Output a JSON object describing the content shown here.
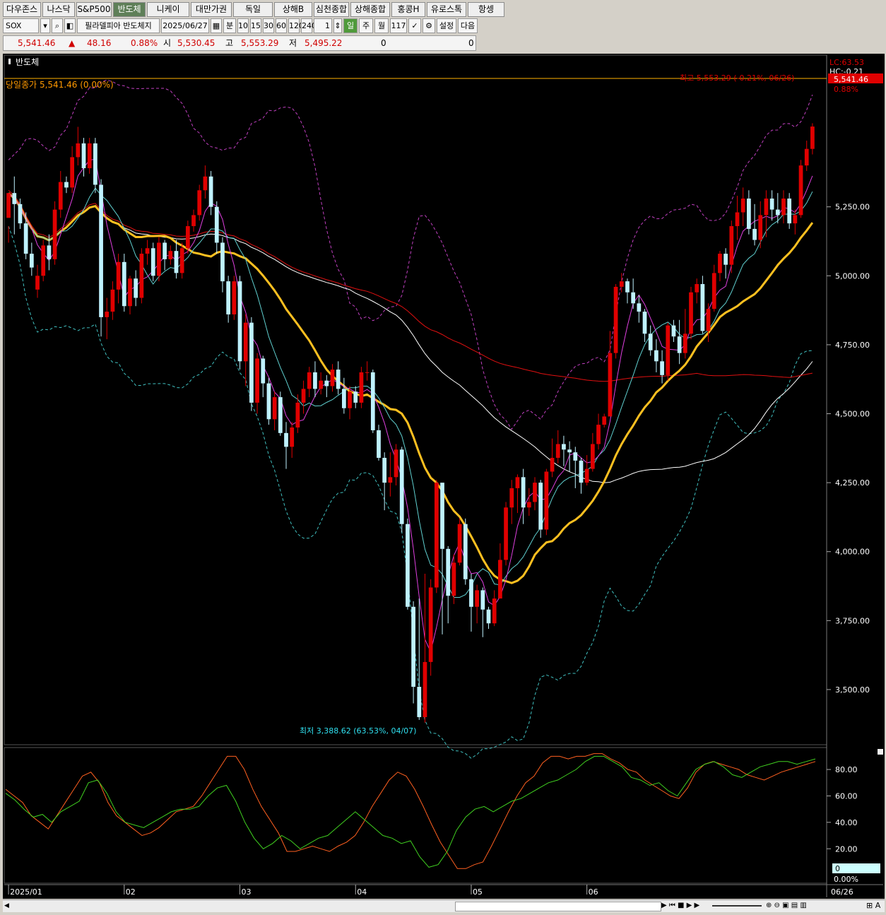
{
  "tabs": [
    {
      "label": "다우존스",
      "w": 52
    },
    {
      "label": "나스닥",
      "w": 44
    },
    {
      "label": "S&P500",
      "w": 48
    },
    {
      "label": "반도체",
      "w": 44,
      "active": true
    },
    {
      "label": "니케이",
      "w": 58
    },
    {
      "label": "대만가권",
      "w": 56
    },
    {
      "label": "독일",
      "w": 54
    },
    {
      "label": "상해B",
      "w": 52
    },
    {
      "label": "심천종합",
      "w": 48
    },
    {
      "label": "상해종합",
      "w": 54
    },
    {
      "label": "홍콩H",
      "w": 46
    },
    {
      "label": "유로스톡",
      "w": 54
    },
    {
      "label": "항셍",
      "w": 50
    }
  ],
  "toolbar": {
    "symbol": "SOX",
    "name": "필라델피아 반도체지",
    "date": "2025/06/27",
    "unit_buttons": [
      "분",
      "10",
      "15",
      "30",
      "60",
      "120",
      "240"
    ],
    "period_count": "1",
    "period_buttons": [
      "일",
      "주",
      "월"
    ],
    "bar_count": "117",
    "settings_label": "설정",
    "next_label": "다음"
  },
  "quote": {
    "price": "5,541.46",
    "arrow": "▲",
    "change": "48.16",
    "pct": "0.88%",
    "open_label": "시",
    "open": "5,530.45",
    "high_label": "고",
    "high": "5,553.29",
    "low_label": "저",
    "low": "5,495.22",
    "vol1": "0",
    "vol2": "0"
  },
  "chart_title": "반도체",
  "legend_close": "당일종가 5,541.46 (0.00%)",
  "high_note": "최고 5,553.29 (-0.21%, 06/26)",
  "low_note": "최저 3,388.62 (63.53%, 04/07)",
  "right_badges": {
    "lc": "LC:63.53",
    "hc": "HC:-0.21",
    "price": "5,541.46",
    "pct": "0.88%",
    "pct_low": "0.00%",
    "stoch_val": "0"
  },
  "colors": {
    "up": "#e00000",
    "down": "#bff2ff",
    "ma5": "#e040e0",
    "ma10": "#60d0d0",
    "ma20": "#ffc020",
    "ma60": "#ffffff",
    "ma120": "#e01010",
    "band_up": "#c040c0",
    "band_dn": "#40c0c0",
    "stoch_k": "#ff6020",
    "stoch_d": "#40d020"
  },
  "chart_data": [
    {
      "type": "candlestick",
      "title": "반도체",
      "y_ticks": [
        5250,
        5000,
        4750,
        4500,
        4250,
        4000,
        3750,
        3500
      ],
      "ylim": [
        3300,
        5800
      ],
      "x_labels": [
        "2025/01",
        "02",
        "03",
        "04",
        "05",
        "06",
        "06/26"
      ],
      "x_label_index": [
        0,
        20,
        40,
        60,
        80,
        100,
        115
      ],
      "candles": [
        [
          5210,
          5300,
          5180,
          5120
        ],
        [
          5300,
          5260,
          5360,
          5150
        ],
        [
          5260,
          5190,
          5280,
          5170
        ],
        [
          5190,
          5080,
          5230,
          5060
        ],
        [
          5080,
          5030,
          5120,
          5000
        ],
        [
          4950,
          5000,
          5040,
          4920
        ],
        [
          5000,
          5110,
          5130,
          4980
        ],
        [
          5110,
          5060,
          5150,
          5020
        ],
        [
          5060,
          5240,
          5270,
          5040
        ],
        [
          5240,
          5340,
          5380,
          5210
        ],
        [
          5340,
          5320,
          5360,
          5300
        ],
        [
          5320,
          5430,
          5470,
          5300
        ],
        [
          5430,
          5480,
          5540,
          5400
        ],
        [
          5480,
          5390,
          5500,
          5360
        ],
        [
          5390,
          5480,
          5500,
          5370
        ],
        [
          5480,
          5330,
          5500,
          5300
        ],
        [
          5330,
          4850,
          5350,
          4780
        ],
        [
          4850,
          4870,
          4920,
          4770
        ],
        [
          4870,
          4950,
          4980,
          4840
        ],
        [
          4950,
          5050,
          5080,
          4900
        ],
        [
          5050,
          4890,
          5080,
          4870
        ],
        [
          4890,
          4990,
          5000,
          4860
        ],
        [
          4990,
          4920,
          5020,
          4890
        ],
        [
          4920,
          5080,
          5100,
          4900
        ],
        [
          5080,
          5100,
          5130,
          5040
        ],
        [
          5100,
          5000,
          5120,
          4980
        ],
        [
          5000,
          5120,
          5140,
          4980
        ],
        [
          5120,
          5060,
          5130,
          5020
        ],
        [
          5060,
          5090,
          5110,
          5040
        ],
        [
          5090,
          5010,
          5130,
          4990
        ],
        [
          5010,
          5100,
          5120,
          4990
        ],
        [
          5100,
          5180,
          5200,
          5080
        ],
        [
          5180,
          5220,
          5240,
          5160
        ],
        [
          5220,
          5310,
          5330,
          5200
        ],
        [
          5310,
          5360,
          5400,
          5280
        ],
        [
          5360,
          5250,
          5380,
          5220
        ],
        [
          5250,
          5120,
          5270,
          5080
        ],
        [
          5120,
          4980,
          5140,
          4940
        ],
        [
          4980,
          4860,
          5000,
          4830
        ],
        [
          4860,
          4980,
          5000,
          4840
        ],
        [
          4980,
          4690,
          5000,
          4660
        ],
        [
          4690,
          4830,
          4860,
          4600
        ],
        [
          4830,
          4540,
          4850,
          4510
        ],
        [
          4540,
          4700,
          4720,
          4500
        ],
        [
          4700,
          4610,
          4710,
          4560
        ],
        [
          4610,
          4480,
          4630,
          4460
        ],
        [
          4480,
          4560,
          4580,
          4440
        ],
        [
          4560,
          4430,
          4580,
          4420
        ],
        [
          4430,
          4380,
          4470,
          4300
        ],
        [
          4380,
          4450,
          4470,
          4340
        ],
        [
          4450,
          4540,
          4570,
          4430
        ],
        [
          4540,
          4590,
          4620,
          4500
        ],
        [
          4590,
          4650,
          4670,
          4560
        ],
        [
          4650,
          4590,
          4690,
          4560
        ],
        [
          4590,
          4620,
          4650,
          4570
        ],
        [
          4620,
          4600,
          4640,
          4560
        ],
        [
          4600,
          4660,
          4680,
          4580
        ],
        [
          4660,
          4590,
          4690,
          4570
        ],
        [
          4590,
          4520,
          4630,
          4500
        ],
        [
          4520,
          4580,
          4600,
          4480
        ],
        [
          4580,
          4540,
          4600,
          4520
        ],
        [
          4540,
          4650,
          4670,
          4520
        ],
        [
          4650,
          4650,
          4690,
          4620
        ],
        [
          4650,
          4440,
          4660,
          4430
        ],
        [
          4440,
          4340,
          4460,
          4330
        ],
        [
          4340,
          4250,
          4360,
          4150
        ],
        [
          4250,
          4270,
          4360,
          4200
        ],
        [
          4270,
          4370,
          4390,
          4240
        ],
        [
          4370,
          4100,
          4380,
          4070
        ],
        [
          4100,
          3800,
          4120,
          3790
        ],
        [
          3800,
          3510,
          3820,
          3450
        ],
        [
          3510,
          3400,
          3830,
          3390
        ],
        [
          3400,
          3600,
          3920,
          3380
        ],
        [
          3600,
          3870,
          3900,
          3550
        ],
        [
          3870,
          4250,
          4260,
          3850
        ],
        [
          4250,
          4010,
          4030,
          3700
        ],
        [
          4010,
          3840,
          4020,
          3740
        ],
        [
          3840,
          3960,
          3990,
          3810
        ],
        [
          3960,
          4100,
          4120,
          3950
        ],
        [
          4100,
          3900,
          4120,
          3880
        ],
        [
          3900,
          3800,
          3920,
          3710
        ],
        [
          3800,
          3860,
          3880,
          3740
        ],
        [
          3860,
          3790,
          3870,
          3690
        ],
        [
          3790,
          3740,
          3800,
          3720
        ],
        [
          3740,
          3830,
          3860,
          3730
        ],
        [
          3830,
          3970,
          4030,
          3960
        ],
        [
          3970,
          4160,
          4180,
          3950
        ],
        [
          4160,
          4230,
          4260,
          4100
        ],
        [
          4230,
          4270,
          4280,
          4140
        ],
        [
          4270,
          4160,
          4300,
          4100
        ],
        [
          4160,
          4180,
          4230,
          4130
        ],
        [
          4180,
          4250,
          4270,
          4150
        ],
        [
          4250,
          4080,
          4260,
          4050
        ],
        [
          4080,
          4290,
          4300,
          4060
        ],
        [
          4290,
          4340,
          4410,
          4270
        ],
        [
          4340,
          4390,
          4440,
          4320
        ],
        [
          4390,
          4370,
          4420,
          4310
        ],
        [
          4370,
          4360,
          4400,
          4290
        ],
        [
          4360,
          4330,
          4380,
          4230
        ],
        [
          4330,
          4250,
          4340,
          4210
        ],
        [
          4250,
          4300,
          4350,
          4240
        ],
        [
          4300,
          4390,
          4430,
          4290
        ],
        [
          4390,
          4460,
          4500,
          4370
        ],
        [
          4460,
          4490,
          4500,
          4450
        ],
        [
          4490,
          4720,
          4800,
          4710
        ],
        [
          4720,
          4960,
          4970,
          4700
        ],
        [
          4960,
          4980,
          5010,
          4940
        ],
        [
          4980,
          4940,
          4990,
          4900
        ],
        [
          4940,
          4900,
          4990,
          4880
        ],
        [
          4900,
          4870,
          4930,
          4830
        ],
        [
          4870,
          4790,
          4880,
          4760
        ],
        [
          4790,
          4730,
          4820,
          4710
        ],
        [
          4730,
          4690,
          4770,
          4650
        ],
        [
          4690,
          4640,
          4730,
          4610
        ],
        [
          4640,
          4820,
          4830,
          4620
        ],
        [
          4820,
          4780,
          4840,
          4760
        ],
        [
          4780,
          4720,
          4840,
          4680
        ],
        [
          4720,
          4790,
          4880,
          4700
        ],
        [
          4790,
          4940,
          4960,
          4770
        ],
        [
          4940,
          4970,
          4990,
          4900
        ],
        [
          4970,
          4800,
          5000,
          4790
        ],
        [
          4800,
          4880,
          4900,
          4760
        ],
        [
          4880,
          5010,
          5040,
          4870
        ],
        [
          5010,
          5080,
          5090,
          4980
        ],
        [
          5080,
          5040,
          5100,
          4990
        ],
        [
          5040,
          5180,
          5200,
          5010
        ],
        [
          5180,
          5230,
          5290,
          5130
        ],
        [
          5230,
          5280,
          5320,
          5180
        ],
        [
          5280,
          5170,
          5310,
          5150
        ],
        [
          5170,
          5130,
          5260,
          5110
        ],
        [
          5130,
          5220,
          5270,
          5100
        ],
        [
          5220,
          5280,
          5310,
          5140
        ],
        [
          5280,
          5240,
          5310,
          5200
        ],
        [
          5240,
          5220,
          5300,
          5190
        ],
        [
          5220,
          5280,
          5310,
          5190
        ],
        [
          5280,
          5190,
          5300,
          5170
        ],
        [
          5190,
          5220,
          5240,
          5150
        ],
        [
          5220,
          5400,
          5420,
          5210
        ],
        [
          5400,
          5460,
          5490,
          5380
        ],
        [
          5460,
          5541,
          5553,
          5440
        ]
      ]
    },
    {
      "type": "line",
      "title": "",
      "y_ticks": [
        80,
        60,
        40,
        20
      ],
      "ylim": [
        -5,
        95
      ],
      "series": [
        {
          "values": [
            65,
            60,
            55,
            45,
            40,
            35,
            45,
            55,
            65,
            75,
            78,
            70,
            55,
            45,
            40,
            35,
            30,
            32,
            36,
            42,
            48,
            50,
            52,
            60,
            70,
            80,
            90,
            90,
            80,
            65,
            52,
            42,
            32,
            18,
            18,
            20,
            22,
            20,
            18,
            22,
            25,
            30,
            40,
            52,
            62,
            72,
            78,
            75,
            65,
            52,
            38,
            25,
            15,
            5,
            5,
            8,
            10,
            22,
            35,
            48,
            60,
            70,
            75,
            85,
            90,
            90,
            88,
            90,
            90,
            92,
            92,
            88,
            85,
            80,
            78,
            72,
            68,
            64,
            60,
            58,
            66,
            78,
            84,
            86,
            84,
            82,
            80,
            76,
            74,
            72,
            75,
            78,
            80,
            82,
            84,
            86
          ]
        },
        {
          "values": [
            62,
            57,
            50,
            44,
            46,
            40,
            48,
            52,
            56,
            70,
            72,
            62,
            48,
            40,
            38,
            36,
            40,
            44,
            48,
            50,
            50,
            52,
            60,
            66,
            68,
            56,
            40,
            28,
            20,
            24,
            30,
            26,
            20,
            24,
            28,
            30,
            36,
            42,
            48,
            42,
            36,
            30,
            28,
            24,
            26,
            14,
            6,
            8,
            18,
            34,
            44,
            50,
            52,
            48,
            52,
            56,
            58,
            62,
            66,
            70,
            72,
            76,
            80,
            86,
            90,
            90,
            86,
            82,
            74,
            72,
            68,
            70,
            64,
            60,
            70,
            80,
            84,
            86,
            82,
            76,
            74,
            78,
            82,
            84,
            86,
            86,
            84,
            86,
            88
          ]
        }
      ]
    }
  ]
}
